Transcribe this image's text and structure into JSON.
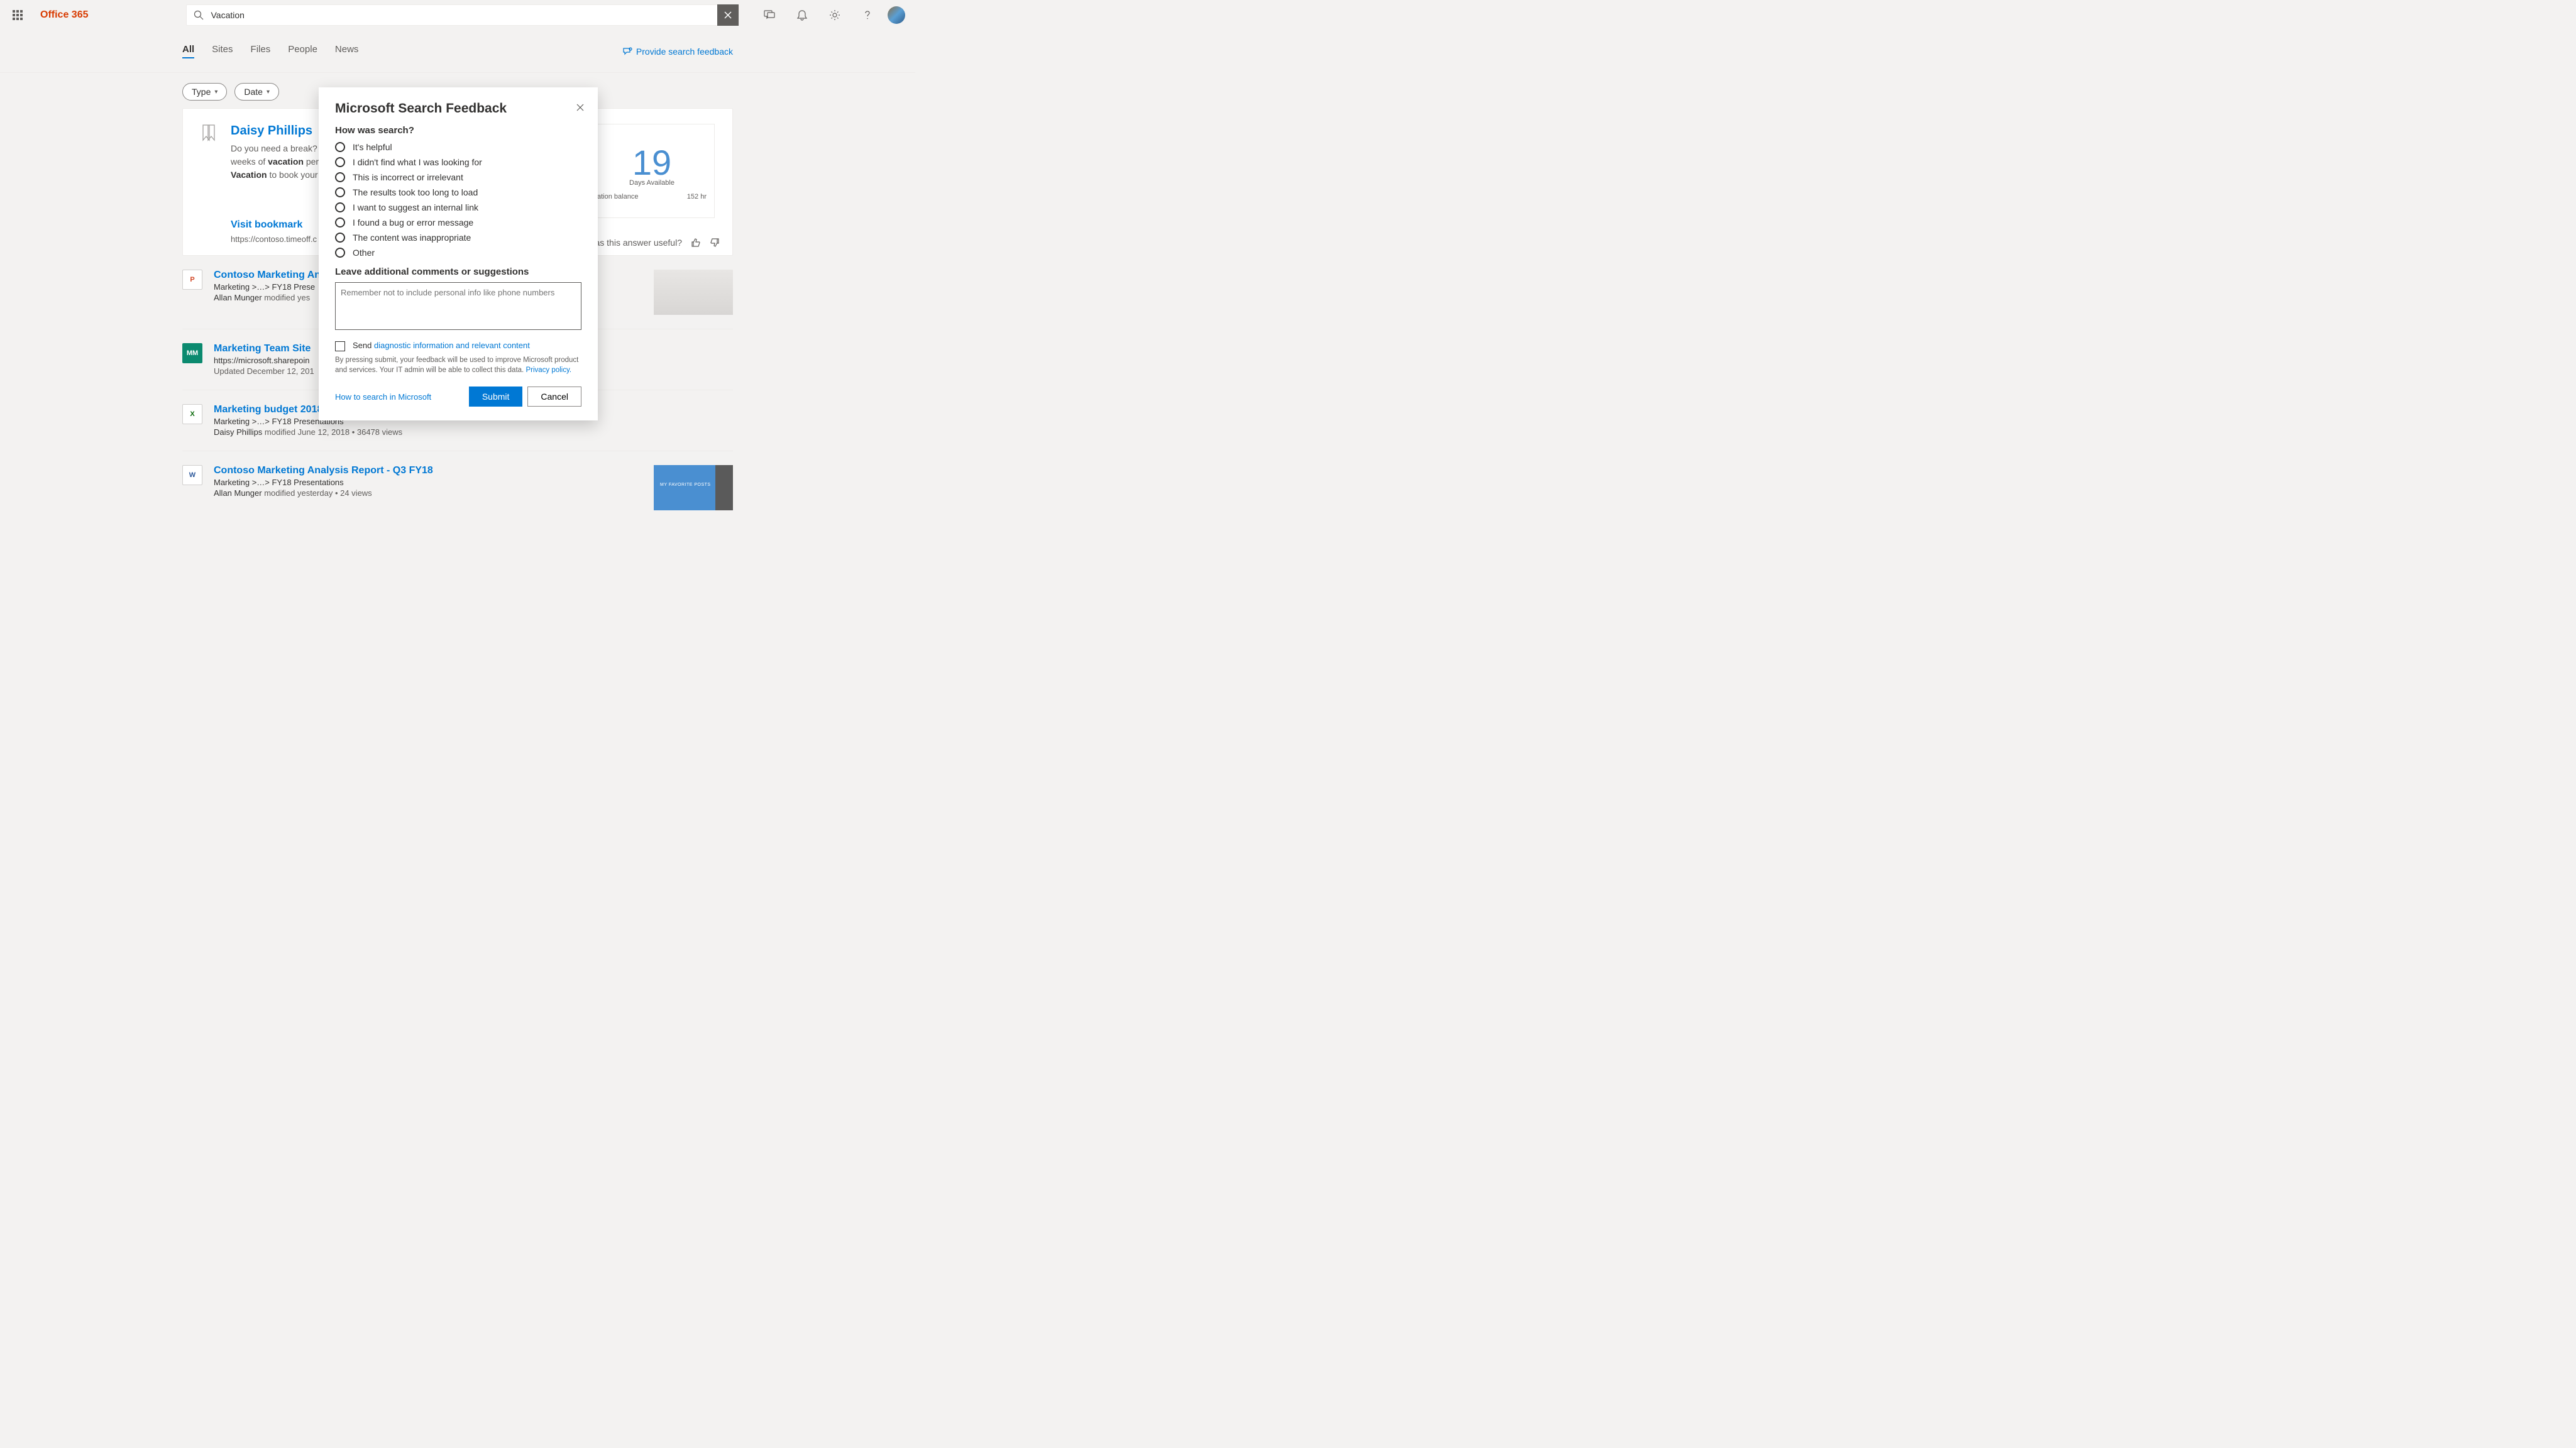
{
  "header": {
    "brand": "Office 365",
    "search_value": "Vacation"
  },
  "subnav": {
    "tabs": [
      "All",
      "Sites",
      "Files",
      "People",
      "News"
    ],
    "feedback_label": "Provide search feedback"
  },
  "filters": {
    "type": "Type",
    "date": "Date"
  },
  "answer": {
    "title": "Daisy Phillips",
    "text_prefix": "Do you need a break?",
    "text_mid1": "weeks of ",
    "kw1": "vacation",
    "text_mid2": " per",
    "kw2": "Vacation",
    "text_mid3": " to book your",
    "visit": "Visit bookmark",
    "url": "https://contoso.timeoff.c",
    "widget_num": "19",
    "widget_label": "Days Available",
    "widget_row_l": "ation balance",
    "widget_row_r": "152  hr",
    "useful_q": "Was this answer useful?"
  },
  "results": [
    {
      "icon": "P",
      "title": "Contoso Marketing An",
      "path": "Marketing >…> FY18 Prese",
      "meta_name": "Allan Munger",
      "meta_rest": " modified yes"
    },
    {
      "icon": "MM",
      "title": "Marketing Team Site",
      "path": "https://microsoft.sharepoin",
      "meta_name": "",
      "meta_rest": "Updated December 12, 201"
    },
    {
      "icon": "X",
      "title": "Marketing budget 2018",
      "path": "Marketing >…> FY18 Presentations",
      "meta_name": "Daisy Phillips",
      "meta_rest": " modified June 12, 2018  •  36478 views"
    },
    {
      "icon": "W",
      "title": "Contoso Marketing Analysis Report - Q3 FY18",
      "path": "Marketing >…> FY18 Presentations",
      "meta_name": "Allan Munger",
      "meta_rest": " modified yesterday  •  24 views"
    }
  ],
  "modal": {
    "title": "Microsoft Search Feedback",
    "q1": "How was search?",
    "options": [
      "It's helpful",
      "I didn't find what I was looking for",
      "This is incorrect or irrelevant",
      "The results took too long to load",
      "I want to suggest an internal link",
      "I found a bug or error message",
      "The content was inappropriate",
      "Other"
    ],
    "q2": "Leave additional comments or suggestions",
    "placeholder": "Remember not to include personal info like phone numbers",
    "send_prefix": "Send ",
    "diag_link": "diagnostic information and relevant content",
    "disclaimer": "By pressing submit, your feedback will be used to improve Microsoft product and services. Your IT admin will be able to collect this data. ",
    "privacy": "Privacy policy.",
    "help": "How to search in Microsoft",
    "submit": "Submit",
    "cancel": "Cancel"
  },
  "thumb2_text": "MY FAVORITE POSTS"
}
